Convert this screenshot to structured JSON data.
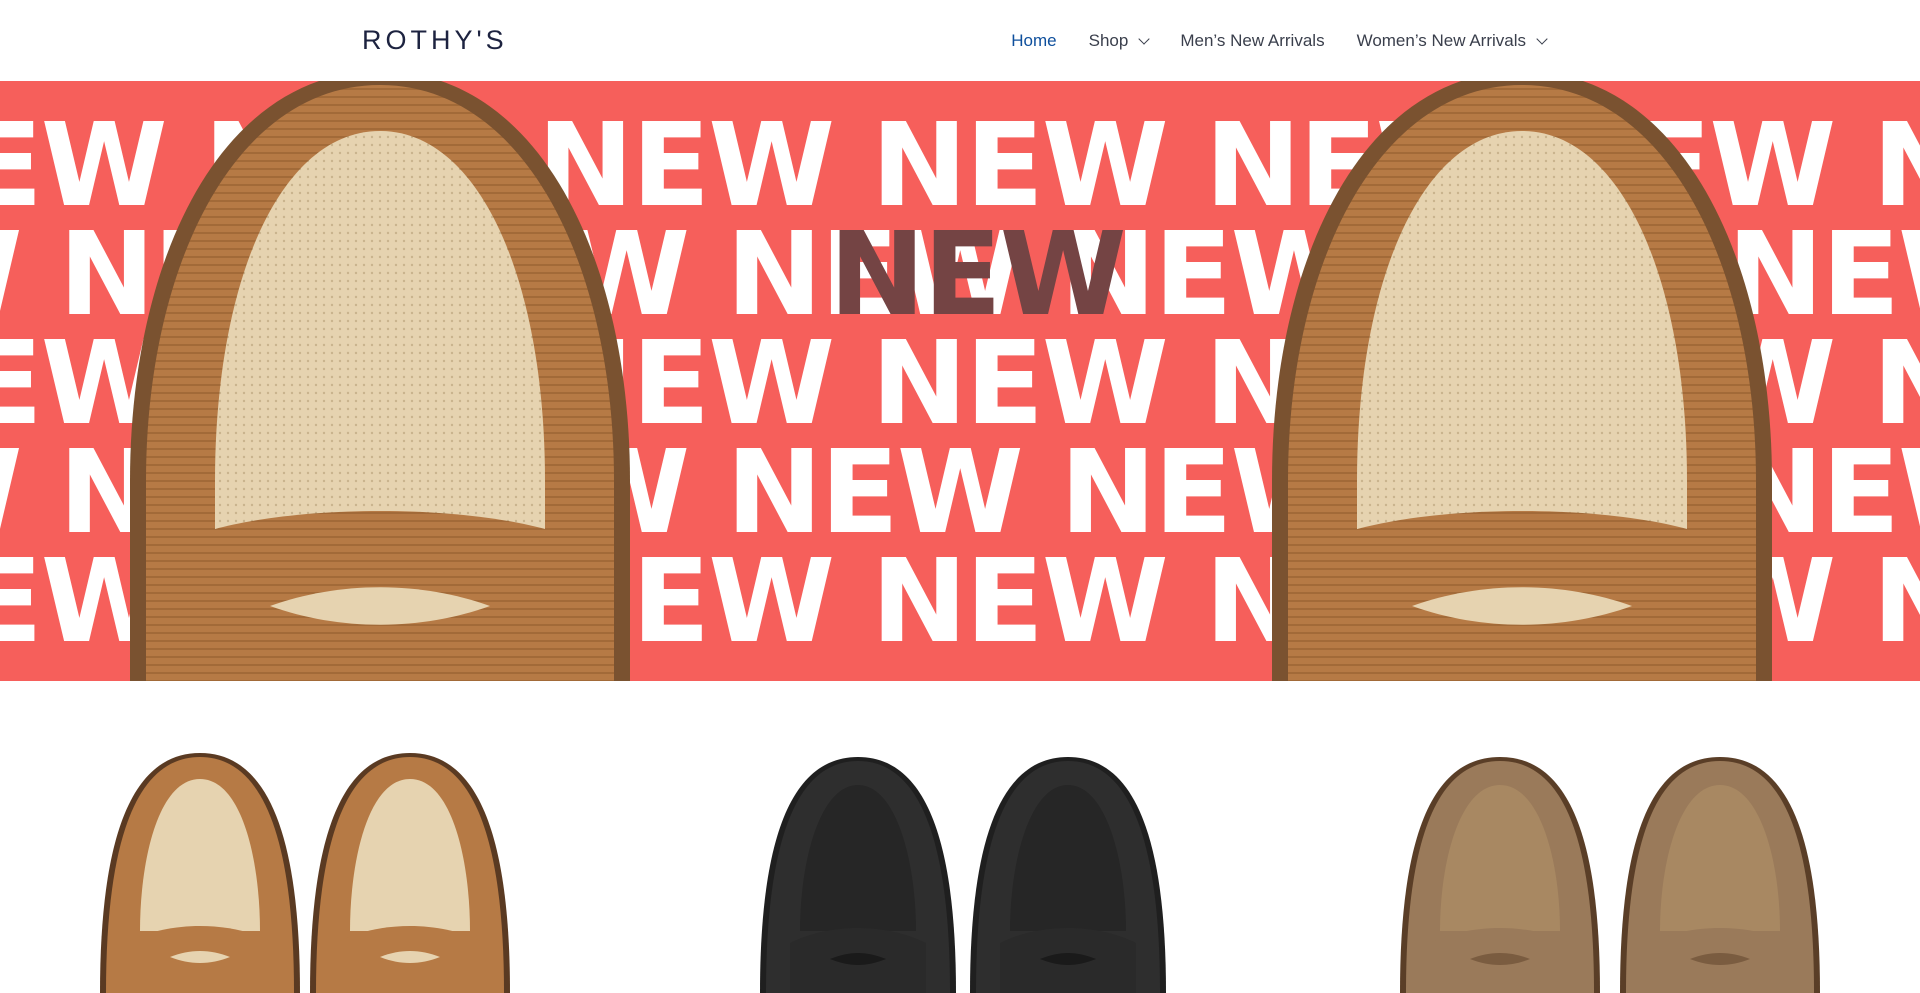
{
  "header": {
    "logo": "ROTHY'S",
    "nav": [
      {
        "label": "Home",
        "active": true,
        "dropdown": false
      },
      {
        "label": "Shop",
        "active": false,
        "dropdown": true
      },
      {
        "label": "Men’s New Arrivals",
        "active": false,
        "dropdown": false
      },
      {
        "label": "Women’s New Arrivals",
        "active": false,
        "dropdown": true
      }
    ]
  },
  "hero": {
    "word": "NEW",
    "background": "#f65f5b",
    "highlight_color": "#744444",
    "shoe_color": "tan"
  },
  "products": [
    {
      "color_name": "tan and cream",
      "upper": "#b67a45",
      "inner": "#e6d3b0"
    },
    {
      "color_name": "black",
      "upper": "#2a2a2a",
      "inner": "#2a2a2a"
    },
    {
      "color_name": "taupe",
      "upper": "#9a7a5a",
      "inner": "#a88862"
    }
  ],
  "colors": {
    "active_nav": "#0e4f9c",
    "text": "#3a3f4c",
    "logo": "#1d2340"
  }
}
